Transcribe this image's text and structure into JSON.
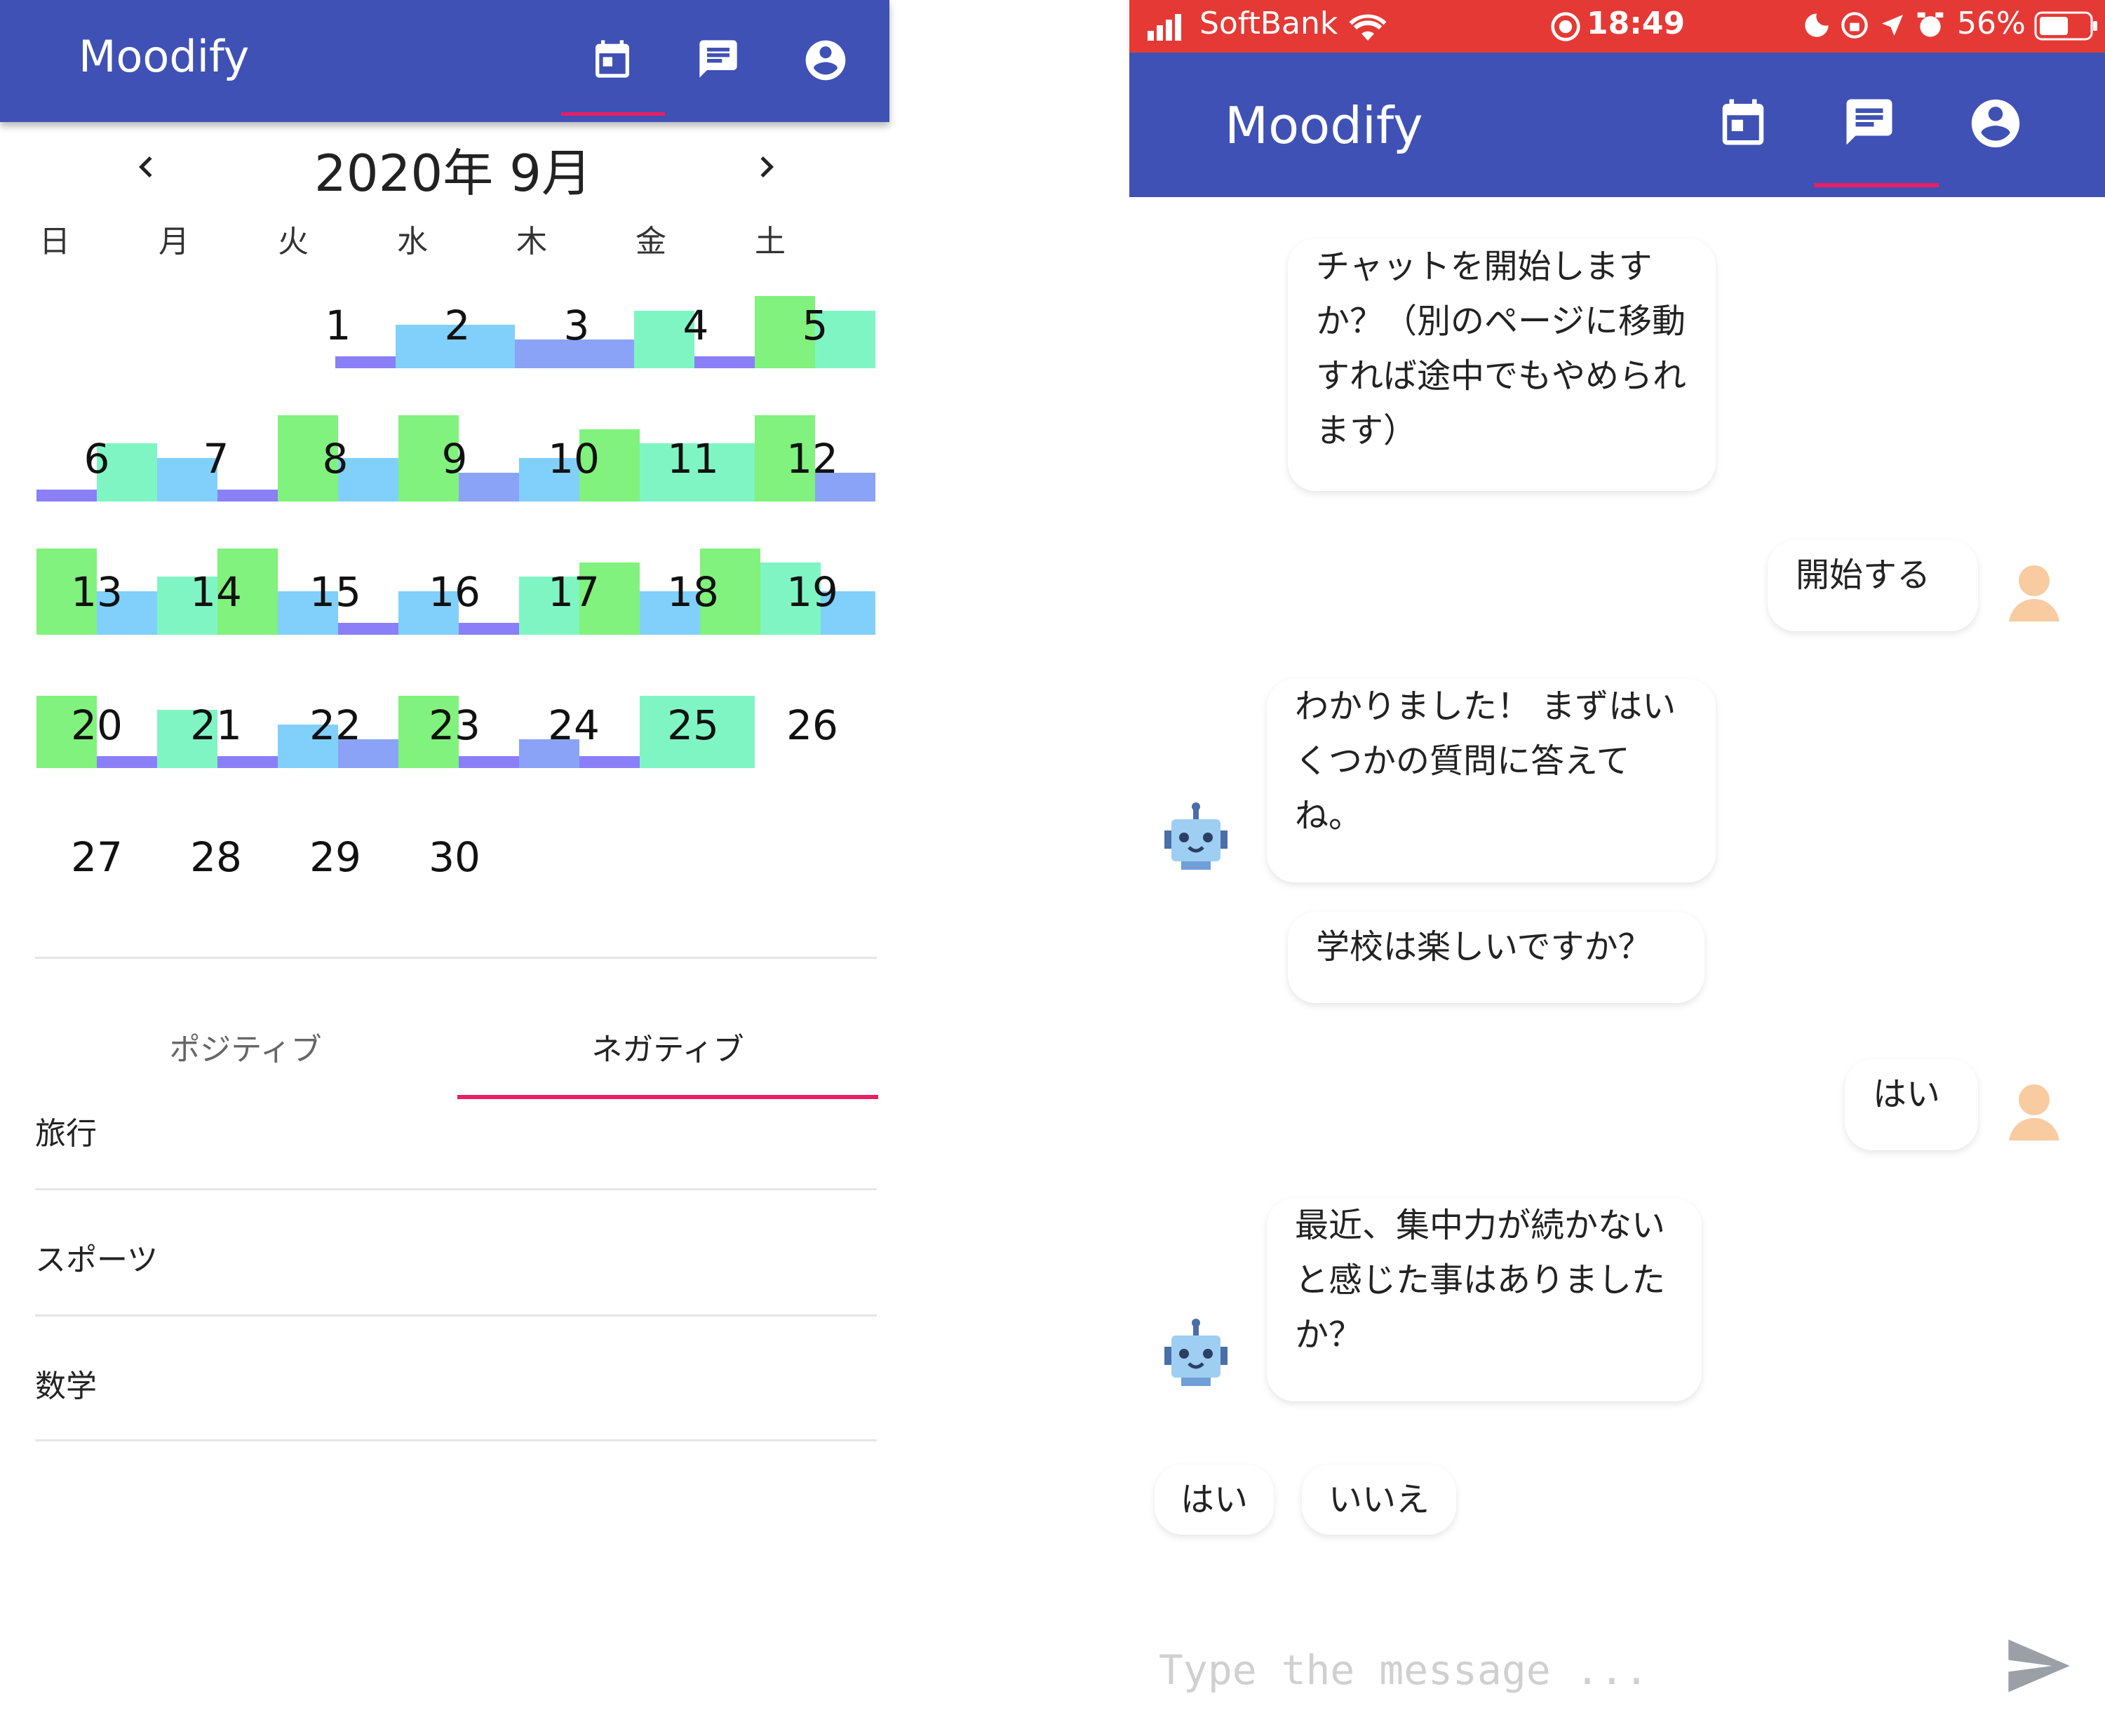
{
  "left_screen": {
    "app_title": "Moodify",
    "nav": {
      "calendar_icon": "calendar-icon",
      "chat_icon": "chat-icon",
      "account_icon": "account-circle-icon",
      "active": "calendar"
    },
    "calendar": {
      "month_title": "2020年 9月",
      "prev_icon": "chevron-left-icon",
      "next_icon": "chevron-right-icon",
      "weekdays": [
        "日",
        "月",
        "火",
        "水",
        "木",
        "金",
        "土"
      ],
      "days": [
        {
          "n": "1"
        },
        {
          "n": "2"
        },
        {
          "n": "3"
        },
        {
          "n": "4"
        },
        {
          "n": "5"
        },
        {
          "n": "6"
        },
        {
          "n": "7"
        },
        {
          "n": "8"
        },
        {
          "n": "9"
        },
        {
          "n": "10"
        },
        {
          "n": "11"
        },
        {
          "n": "12"
        },
        {
          "n": "13"
        },
        {
          "n": "14"
        },
        {
          "n": "15"
        },
        {
          "n": "16"
        },
        {
          "n": "17"
        },
        {
          "n": "18"
        },
        {
          "n": "19"
        },
        {
          "n": "20"
        },
        {
          "n": "21"
        },
        {
          "n": "22"
        },
        {
          "n": "23"
        },
        {
          "n": "24"
        },
        {
          "n": "25"
        },
        {
          "n": "26"
        },
        {
          "n": "27"
        },
        {
          "n": "28"
        },
        {
          "n": "29"
        },
        {
          "n": "30"
        }
      ],
      "colors": {
        "green": "#80f27d",
        "mint": "#80f5c4",
        "sky": "#80d0fb",
        "blue": "#8aa3f6",
        "purple": "#8a7ff6"
      }
    },
    "tabs": [
      "ポジティブ",
      "ネガティブ"
    ],
    "active_tab": "ネガティブ",
    "list": [
      "旅行",
      "スポーツ",
      "数学"
    ]
  },
  "right_screen": {
    "status": {
      "carrier": "SoftBank",
      "time": "18:49",
      "battery": "56%"
    },
    "app_title": "Moodify",
    "nav": {
      "calendar_icon": "calendar-icon",
      "chat_icon": "chat-icon",
      "account_icon": "account-circle-icon",
      "active": "chat"
    },
    "messages": {
      "bot_1": "チャットを開始しますか？（別のページに移動すれば途中でもやめられます）",
      "user_1": "開始する",
      "bot_2": "わかりました！ まずはいくつかの質問に答えてね。",
      "bot_3": "学校は楽しいですか？",
      "user_2": "はい",
      "bot_4": "最近、集中力が続かないと感じた事はありましたか？"
    },
    "quick_replies": [
      "はい",
      "いいえ"
    ],
    "input": {
      "placeholder": "Type the message ..."
    },
    "send_icon": "send-icon"
  }
}
